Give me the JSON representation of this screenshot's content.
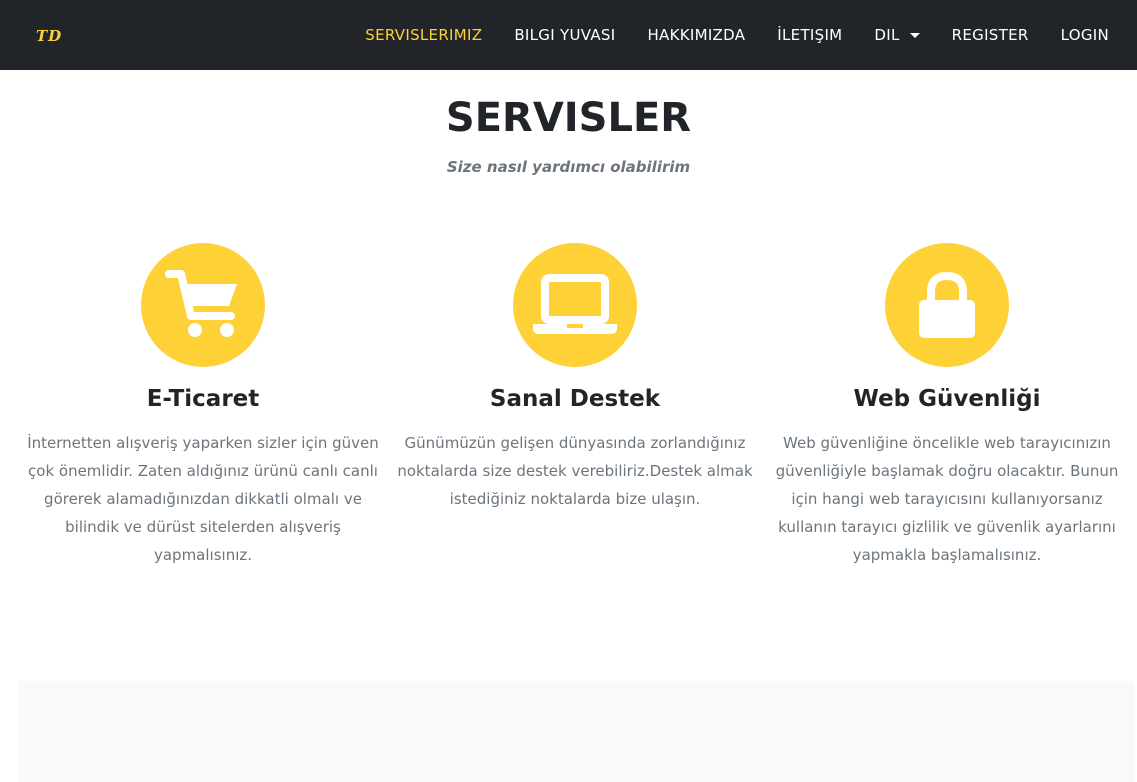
{
  "brand": "TD",
  "nav": {
    "items": [
      {
        "label": "SERVISLERIMIZ",
        "active": true
      },
      {
        "label": "BILGI YUVASI"
      },
      {
        "label": "HAKKIMIZDA"
      },
      {
        "label": "İLETIŞIM"
      },
      {
        "label": "DIL",
        "dropdown": true
      },
      {
        "label": "REGISTER"
      },
      {
        "label": "LOGIN"
      }
    ]
  },
  "section": {
    "heading": "SERVISLER",
    "subheading": "Size nasıl yardımcı olabilirim"
  },
  "services": [
    {
      "icon": "shopping-cart-icon",
      "title": "E-Ticaret",
      "text": "İnternetten alışveriş yaparken sizler için güven çok önemlidir. Zaten aldığınız ürünü canlı canlı görerek alamadığınızdan dikkatli olmalı ve bilindik ve dürüst sitelerden alışveriş yapmalısınız."
    },
    {
      "icon": "laptop-icon",
      "title": "Sanal Destek",
      "text": "Günümüzün gelişen dünyasında zorlandığınız noktalarda size destek verebiliriz.Destek almak istediğiniz noktalarda bize ulaşın."
    },
    {
      "icon": "lock-icon",
      "title": "Web Güvenliği",
      "text": "Web güvenliğine öncelikle web tarayıcınızın güvenliğiyle başlamak doğru olacaktır. Bunun için hangi web tarayıcısını kullanıyorsanız kullanın tarayıcı gizlilik ve güvenlik ayarlarını yapmakla başlamalısınız."
    }
  ],
  "colors": {
    "accent": "#fed136",
    "navbar": "#212529",
    "heading": "#212529",
    "muted": "#6c757d",
    "band": "#f8f9fa"
  }
}
